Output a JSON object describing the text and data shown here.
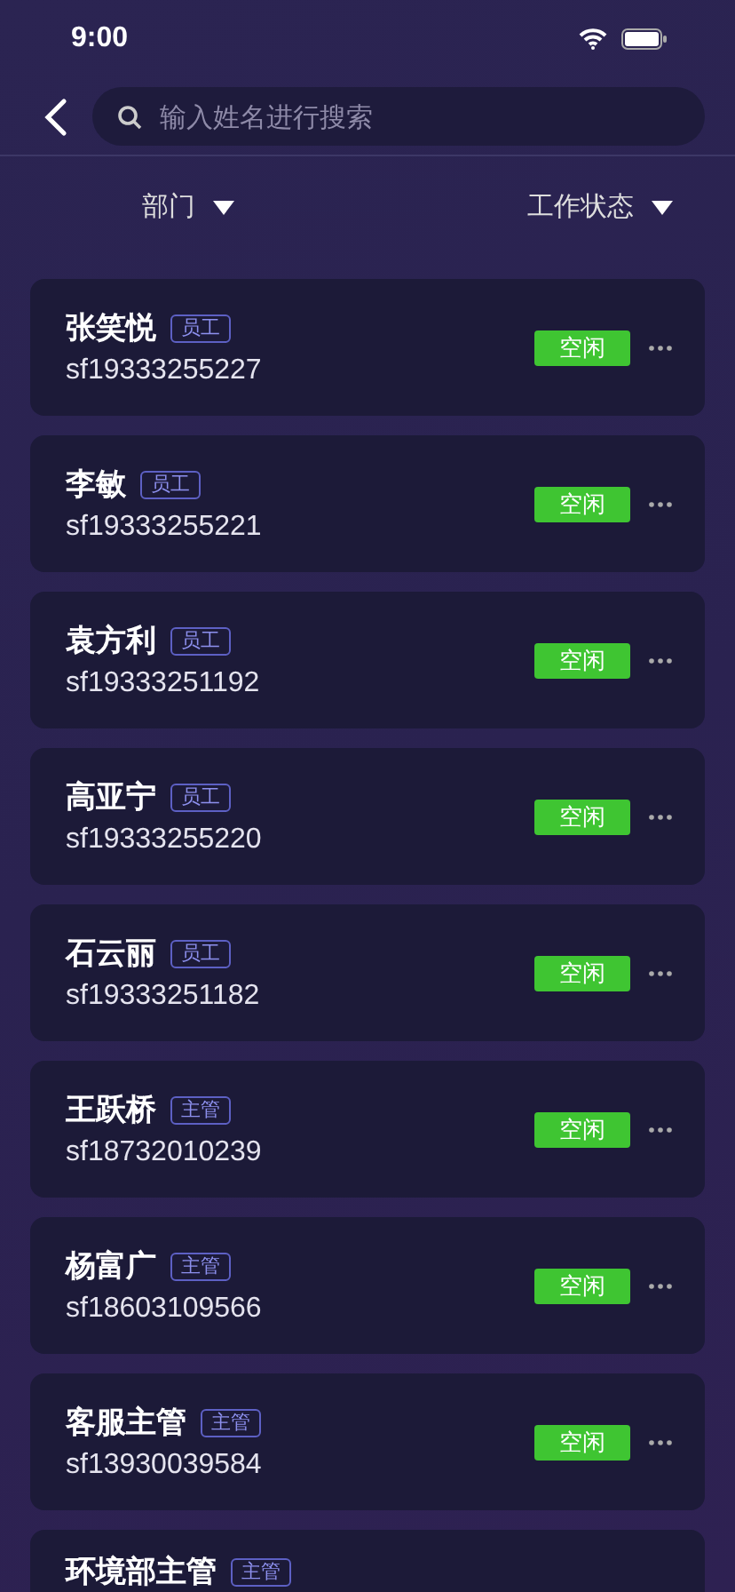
{
  "status_bar": {
    "time": "9:00"
  },
  "search": {
    "placeholder": "输入姓名进行搜索"
  },
  "filters": [
    {
      "label": "部门"
    },
    {
      "label": "工作状态"
    }
  ],
  "staff": [
    {
      "name": "张笑悦",
      "role": "员工",
      "id": "sf19333255227",
      "status": "空闲"
    },
    {
      "name": "李敏",
      "role": "员工",
      "id": "sf19333255221",
      "status": "空闲"
    },
    {
      "name": "袁方利",
      "role": "员工",
      "id": "sf19333251192",
      "status": "空闲"
    },
    {
      "name": "高亚宁",
      "role": "员工",
      "id": "sf19333255220",
      "status": "空闲"
    },
    {
      "name": "石云丽",
      "role": "员工",
      "id": "sf19333251182",
      "status": "空闲"
    },
    {
      "name": "王跃桥",
      "role": "主管",
      "id": "sf18732010239",
      "status": "空闲"
    },
    {
      "name": "杨富广",
      "role": "主管",
      "id": "sf18603109566",
      "status": "空闲"
    },
    {
      "name": "客服主管",
      "role": "主管",
      "id": "sf13930039584",
      "status": "空闲"
    },
    {
      "name": "环境部主管",
      "role": "主管"
    }
  ]
}
